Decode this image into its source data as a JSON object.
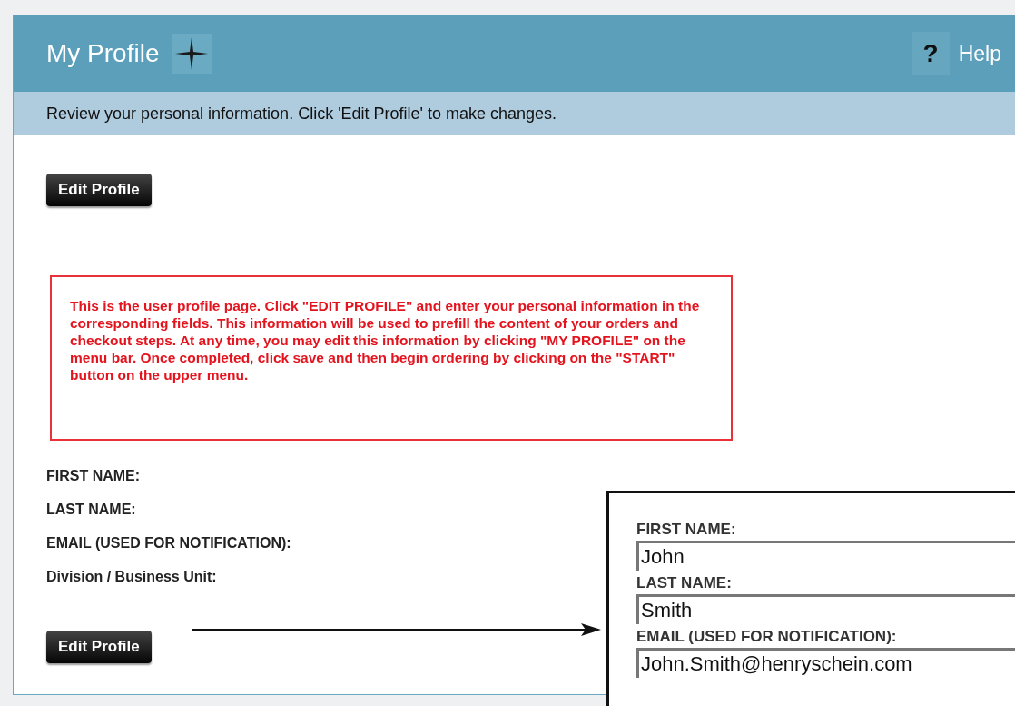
{
  "header": {
    "title": "My Profile",
    "help": {
      "icon": "?",
      "label": "Help"
    }
  },
  "subheader": "Review your personal information. Click 'Edit Profile' to make changes.",
  "top_button": "Edit Profile",
  "note": "This is the user profile page. Click \"EDIT PROFILE\" and enter your personal information in the corresponding fields. This information will be used to prefill the content of your orders and checkout steps. At any time, you may edit this information by clicking \"MY PROFILE\" on the menu bar. Once completed, click save and then begin ordering by clicking on the \"START\" button on the upper menu.",
  "fields": [
    "FIRST NAME:",
    "LAST NAME:",
    "EMAIL (USED FOR NOTIFICATION):",
    "Division / Business Unit:"
  ],
  "bottom_button": "Edit Profile",
  "inset": {
    "fields": [
      {
        "label": "FIRST NAME:",
        "value": "John"
      },
      {
        "label": "LAST NAME:",
        "value": "Smith"
      },
      {
        "label": "EMAIL (USED FOR NOTIFICATION):",
        "value": "John.Smith@henryschein.com"
      }
    ]
  }
}
